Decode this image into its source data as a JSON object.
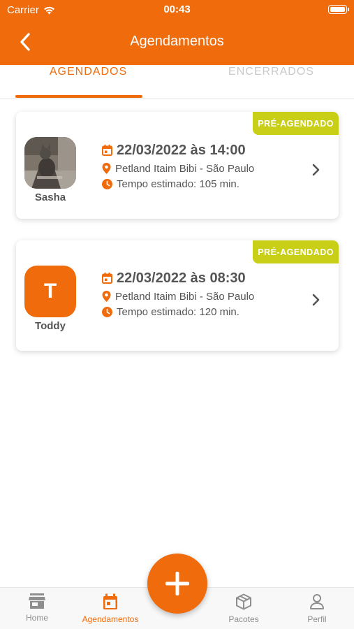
{
  "status_bar": {
    "carrier": "Carrier",
    "time": "00:43"
  },
  "header": {
    "title": "Agendamentos"
  },
  "tabs": [
    {
      "label": "AGENDADOS",
      "active": true
    },
    {
      "label": "ENCERRADOS",
      "active": false
    }
  ],
  "appointments": [
    {
      "badge": "PRÉ-AGENDADO",
      "pet_name": "Sasha",
      "avatar_type": "photo",
      "datetime": "22/03/2022 às 14:00",
      "location": "Petland Itaim Bibi - São Paulo",
      "duration": "Tempo estimado: 105 min."
    },
    {
      "badge": "PRÉ-AGENDADO",
      "pet_name": "Toddy",
      "avatar_type": "letter",
      "avatar_letter": "T",
      "datetime": "22/03/2022 às 08:30",
      "location": "Petland Itaim Bibi - São Paulo",
      "duration": "Tempo estimado: 120 min."
    }
  ],
  "bottom_nav": [
    {
      "label": "Home",
      "icon": "store-icon",
      "active": false
    },
    {
      "label": "Agendamentos",
      "icon": "calendar-icon",
      "active": true
    },
    {
      "label": "Pacotes",
      "icon": "package-icon",
      "active": false
    },
    {
      "label": "Perfil",
      "icon": "person-icon",
      "active": false
    }
  ],
  "fab_icon": "plus-icon",
  "colors": {
    "primary": "#ef6b0c",
    "badge": "#c9cf17",
    "text": "#555555",
    "inactive": "#c9c9c9"
  }
}
